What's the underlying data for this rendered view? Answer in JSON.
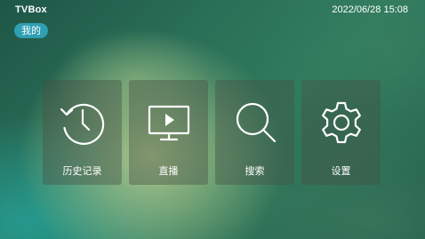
{
  "app": {
    "title": "TVBox",
    "datetime": "2022/06/28 15:08"
  },
  "tabs": [
    {
      "label": "我的",
      "selected": true
    }
  ],
  "tiles": [
    {
      "label": "历史记录",
      "icon": "history-icon"
    },
    {
      "label": "直播",
      "icon": "live-tv-icon"
    },
    {
      "label": "搜索",
      "icon": "search-icon"
    },
    {
      "label": "设置",
      "icon": "gear-icon"
    }
  ],
  "colors": {
    "tab_active": "#2f9fb2",
    "tile_bg": "rgba(70,80,70,0.42)",
    "text": "#ffffff"
  }
}
